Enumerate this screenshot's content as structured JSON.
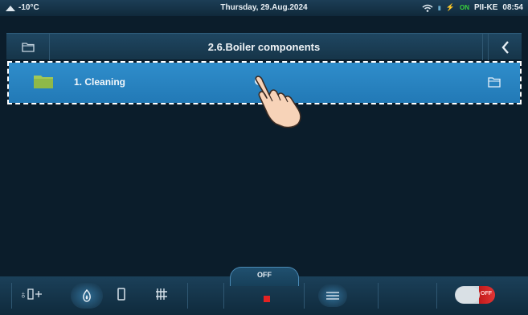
{
  "status_bar": {
    "outdoor_temp": "-10°C",
    "date": "Thursday, 29.Aug.2024",
    "on_indicator": "ON",
    "network_indicator": "PII-KE",
    "time": "08:54"
  },
  "header": {
    "title": "2.6.Boiler components"
  },
  "list": {
    "items": [
      {
        "label": "1.  Cleaning"
      }
    ]
  },
  "bottom_bar": {
    "mode_label": "OFF",
    "toggle_label": "OFF"
  },
  "colors": {
    "background": "#0b1d2b",
    "header": "#1f4661",
    "selected_row": "#2f8dcb",
    "accent_red": "#e32222",
    "status_on": "#39d23c"
  },
  "icons": {
    "header_left": "folder-icon",
    "header_right": "back-chevron-icon",
    "row_left": "folder-icon",
    "row_right": "folder-open-icon",
    "pointer": "hand-pointer-icon",
    "bottom": [
      "outdoor-mode-icon",
      "flame-icon",
      "boiler-icon",
      "radiator-icon",
      "stop-icon",
      "menu-icon",
      "power-toggle"
    ]
  }
}
